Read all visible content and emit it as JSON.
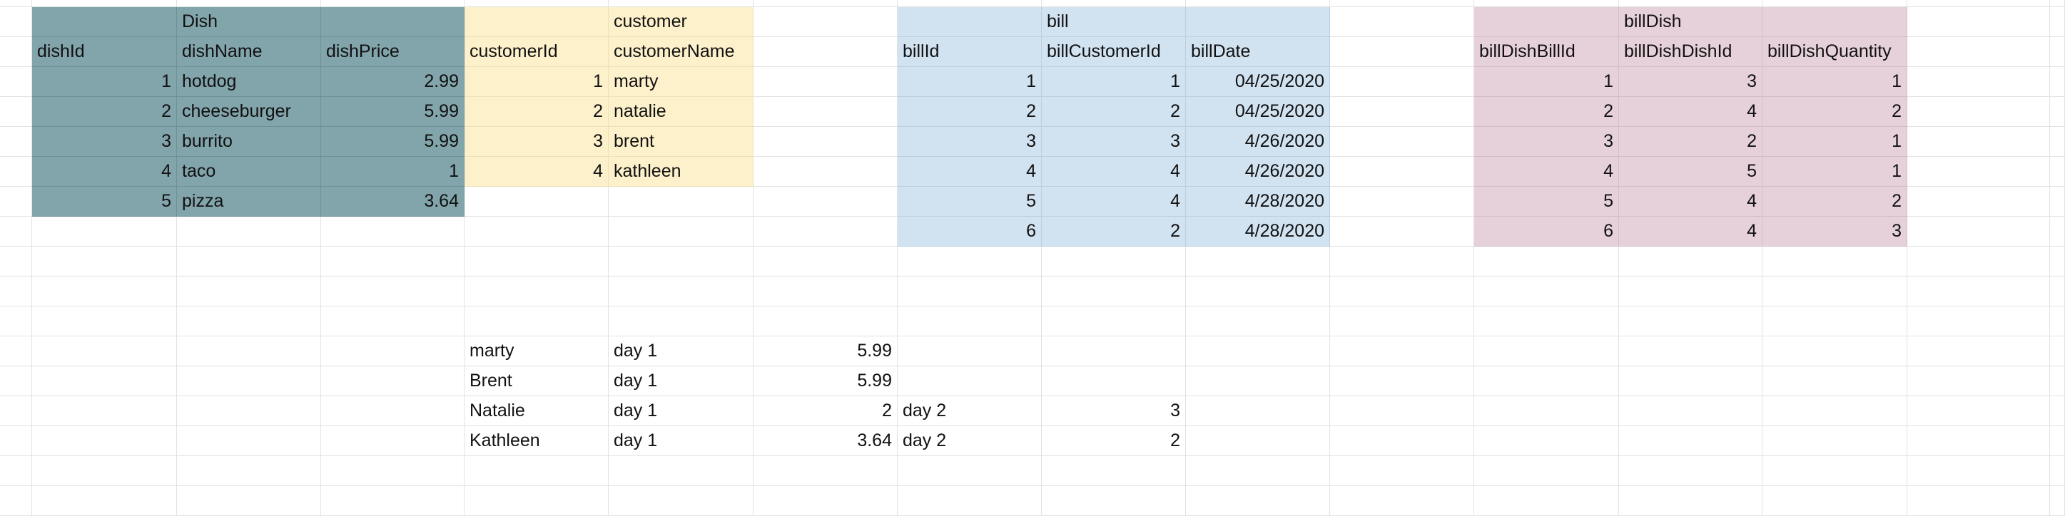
{
  "sheet": {
    "table_fills": {
      "dish": "#82a4ab",
      "customer": "#fdf1cb",
      "bill": "#d1e2f1",
      "billDish": "#e6d1da"
    },
    "grid_line_color": "#e2e2e2"
  },
  "dish_table": {
    "title": "Dish",
    "headers": [
      "dishId",
      "dishName",
      "dishPrice"
    ],
    "rows": [
      [
        "1",
        "hotdog",
        "2.99"
      ],
      [
        "2",
        "cheeseburger",
        "5.99"
      ],
      [
        "3",
        "burrito",
        "5.99"
      ],
      [
        "4",
        "taco",
        "1"
      ],
      [
        "5",
        "pizza",
        "3.64"
      ]
    ]
  },
  "customer_table": {
    "title": "customer",
    "headers": [
      "customerId",
      "customerName"
    ],
    "rows": [
      [
        "1",
        "marty"
      ],
      [
        "2",
        "natalie"
      ],
      [
        "3",
        "brent"
      ],
      [
        "4",
        "kathleen"
      ]
    ]
  },
  "bill_table": {
    "title": "bill",
    "headers": [
      "billId",
      "billCustomerId",
      "billDate"
    ],
    "rows": [
      [
        "1",
        "1",
        "04/25/2020"
      ],
      [
        "2",
        "2",
        "04/25/2020"
      ],
      [
        "3",
        "3",
        "4/26/2020"
      ],
      [
        "4",
        "4",
        "4/26/2020"
      ],
      [
        "5",
        "4",
        "4/28/2020"
      ],
      [
        "6",
        "2",
        "4/28/2020"
      ]
    ]
  },
  "billdish_table": {
    "title": "billDish",
    "headers": [
      "billDishBillId",
      "billDishDishId",
      "billDishQuantity"
    ],
    "rows": [
      [
        "1",
        "3",
        "1"
      ],
      [
        "2",
        "4",
        "2"
      ],
      [
        "3",
        "2",
        "1"
      ],
      [
        "4",
        "5",
        "1"
      ],
      [
        "5",
        "4",
        "2"
      ],
      [
        "6",
        "4",
        "3"
      ]
    ]
  },
  "notes": {
    "rows": [
      [
        "marty",
        "day 1",
        "5.99",
        "",
        ""
      ],
      [
        "Brent",
        "day 1",
        "5.99",
        "",
        ""
      ],
      [
        "Natalie",
        "day 1",
        "2",
        "day 2",
        "3"
      ],
      [
        "Kathleen",
        "day 1",
        "3.64",
        "day 2",
        "2"
      ]
    ]
  }
}
